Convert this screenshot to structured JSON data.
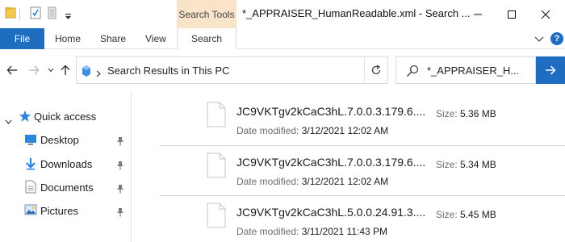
{
  "window": {
    "title": "*_APPRAISER_HumanReadable.xml - Search ...",
    "context_tab_label": "Search Tools"
  },
  "ribbon": {
    "tabs": [
      "File",
      "Home",
      "Share",
      "View",
      "Search"
    ]
  },
  "address": {
    "path": "Search Results in This PC"
  },
  "search": {
    "value": "*_APPRAISER_H..."
  },
  "sidebar": {
    "quick_access_label": "Quick access",
    "items": [
      {
        "label": "Desktop",
        "icon": "desktop-icon",
        "pinned": true
      },
      {
        "label": "Downloads",
        "icon": "downloads-icon",
        "pinned": true
      },
      {
        "label": "Documents",
        "icon": "documents-icon",
        "pinned": true
      },
      {
        "label": "Pictures",
        "icon": "pictures-icon",
        "pinned": true
      }
    ]
  },
  "files": {
    "date_label": "Date modified:",
    "size_label": "Size:",
    "items": [
      {
        "name": "JC9VKTgv2kCaC3hL.7.0.0.3.179.6....",
        "date": "3/12/2021 12:02 AM",
        "size": "5.36 MB"
      },
      {
        "name": "JC9VKTgv2kCaC3hL.7.0.0.3.179.6....",
        "date": "3/12/2021 12:02 AM",
        "size": "5.34 MB"
      },
      {
        "name": "JC9VKTgv2kCaC3hL.5.0.0.24.91.3....",
        "date": "3/11/2021 11:43 PM",
        "size": "5.45 MB"
      }
    ]
  },
  "colors": {
    "accent": "#1e6dc1",
    "search_tools_tab": "#f9e3c9"
  }
}
